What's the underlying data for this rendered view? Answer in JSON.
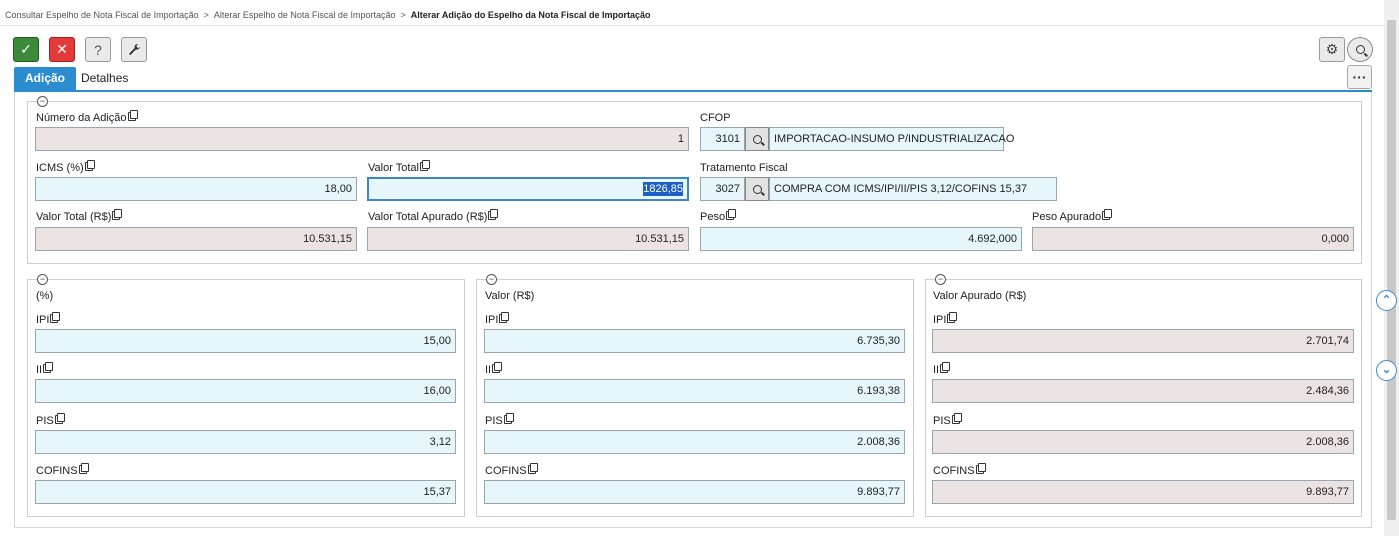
{
  "breadcrumb": {
    "item1": "Consultar Espelho de Nota Fiscal de Importação",
    "item2": "Alterar Espelho de Nota Fiscal de Importação",
    "current": "Alterar Adição do Espelho da Nota Fiscal de Importação",
    "separator": ">"
  },
  "toolbar": {
    "confirm_icon": "✓",
    "cancel_icon": "✕",
    "help_icon": "?",
    "tool_icon": "🔧",
    "gear_icon": "⚙",
    "more_icon": "···"
  },
  "tabs": [
    {
      "label": "Adição",
      "active": true
    },
    {
      "label": "Detalhes",
      "active": false
    }
  ],
  "adicao": {
    "numero": {
      "label": "Número da Adição",
      "value": "1"
    },
    "cfop": {
      "label": "CFOP",
      "code": "3101",
      "description": "IMPORTACAO-INSUMO P/INDUSTRIALIZACAO"
    },
    "icms": {
      "label": "ICMS (%)",
      "value": "18,00"
    },
    "valor_total": {
      "label": "Valor Total",
      "value": "1826,85"
    },
    "tratamento": {
      "label": "Tratamento Fiscal",
      "code": "3027",
      "description": "COMPRA COM ICMS/IPI/II/PIS 3,12/COFINS 15,37"
    },
    "valor_total_rs": {
      "label": "Valor Total (R$)",
      "value": "10.531,15"
    },
    "valor_total_apurado": {
      "label": "Valor Total Apurado (R$)",
      "value": "10.531,15"
    },
    "peso": {
      "label": "Peso",
      "value": "4.692,000"
    },
    "peso_apurado": {
      "label": "Peso Apurado",
      "value": "0,000"
    }
  },
  "percent_panel": {
    "title": "(%)",
    "ipi": {
      "label": "IPI",
      "value": "15,00"
    },
    "ii": {
      "label": "II",
      "value": "16,00"
    },
    "pis": {
      "label": "PIS",
      "value": "3,12"
    },
    "cofins": {
      "label": "COFINS",
      "value": "15,37"
    }
  },
  "valor_panel": {
    "title": "Valor (R$)",
    "ipi": {
      "label": "IPI",
      "value": "6.735,30"
    },
    "ii": {
      "label": "II",
      "value": "6.193,38"
    },
    "pis": {
      "label": "PIS",
      "value": "2.008,36"
    },
    "cofins": {
      "label": "COFINS",
      "value": "9.893,77"
    }
  },
  "apurado_panel": {
    "title": "Valor Apurado (R$)",
    "ipi": {
      "label": "IPI",
      "value": "2.701,74"
    },
    "ii": {
      "label": "II",
      "value": "2.484,36"
    },
    "pis": {
      "label": "PIS",
      "value": "2.008,36"
    },
    "cofins": {
      "label": "COFINS",
      "value": "9.893,77"
    }
  },
  "collapse_icon": "−",
  "nav": {
    "up_icon": "⌃",
    "down_icon": "⌄"
  }
}
